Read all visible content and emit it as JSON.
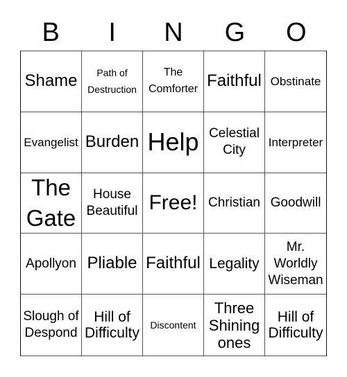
{
  "header": {
    "letters": [
      "B",
      "I",
      "N",
      "G",
      "O"
    ]
  },
  "cells": [
    {
      "text": "Shame",
      "size": "s24"
    },
    {
      "text": "Path of Destruction",
      "size": "s14"
    },
    {
      "text": "The Comforter",
      "size": "s16"
    },
    {
      "text": "Faithful",
      "size": "s24"
    },
    {
      "text": "Obstinate",
      "size": "s17"
    },
    {
      "text": "Evangelist",
      "size": "s17"
    },
    {
      "text": "Burden",
      "size": "s24"
    },
    {
      "text": "Help",
      "size": "s36"
    },
    {
      "text": "Celestial City",
      "size": "s19"
    },
    {
      "text": "Interpreter",
      "size": "s17"
    },
    {
      "text": "The Gate",
      "size": "s33"
    },
    {
      "text": "House Beautiful",
      "size": "s19"
    },
    {
      "text": "Free!",
      "size": "s30"
    },
    {
      "text": "Christian",
      "size": "s19"
    },
    {
      "text": "Goodwill",
      "size": "s19"
    },
    {
      "text": "Apollyon",
      "size": "s19"
    },
    {
      "text": "Pliable",
      "size": "s24"
    },
    {
      "text": "Faithful",
      "size": "s24"
    },
    {
      "text": "Legality",
      "size": "s21"
    },
    {
      "text": "Mr. Worldly Wiseman",
      "size": "s19"
    },
    {
      "text": "Slough of Despond",
      "size": "s19"
    },
    {
      "text": "Hill of Difficulty",
      "size": "s21"
    },
    {
      "text": "Discontent",
      "size": "s14"
    },
    {
      "text": "Three Shining ones",
      "size": "s22"
    },
    {
      "text": "Hill of Difficulty",
      "size": "s21"
    }
  ]
}
